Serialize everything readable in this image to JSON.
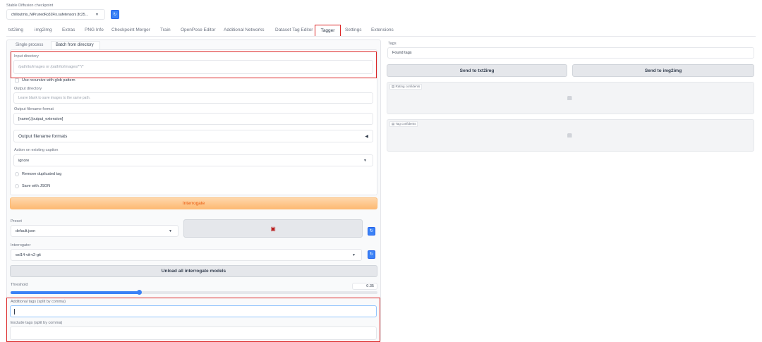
{
  "checkpoint": {
    "label": "Stable Diffusion checkpoint",
    "value": "chilloutmix_NiPrunedFp32Fix.safetensors [fc25…"
  },
  "tabs": [
    "txt2img",
    "img2img",
    "Extras",
    "PNG Info",
    "Checkpoint Merger",
    "Train",
    "OpenPose Editor",
    "Additional Networks",
    "Dataset Tag Editor",
    "Tagger",
    "Settings",
    "Extensions"
  ],
  "active_tab": "Tagger",
  "subtabs": [
    "Single process",
    "Batch from directory"
  ],
  "active_subtab": "Batch from directory",
  "batch": {
    "input_dir_label": "Input directory",
    "input_dir_placeholder": "/path/to/images or /path/to/images/**/*",
    "recursive_label": "Use recursive with glob pattern",
    "output_dir_label": "Output directory",
    "output_dir_placeholder": "Leave blank to save images to the same path.",
    "output_format_label": "Output filename format",
    "output_format_value": "[name].[output_extension]",
    "formats_accordion": "Output filename formats",
    "action_label": "Action on existing caption",
    "action_value": "ignore",
    "remove_dup_label": "Remove duplicated tag",
    "save_json_label": "Save with JSON"
  },
  "interrogate_button": "Interrogate",
  "preset": {
    "label": "Preset",
    "value": "default.json"
  },
  "interrogator": {
    "label": "Interrogator",
    "value": "wd14-vit-v2-git"
  },
  "unload_button": "Unload all interrogate models",
  "threshold": {
    "label": "Threshold",
    "value": "0.35",
    "fraction": 0.35
  },
  "additional_tags_label": "Additional tags (split by comma)",
  "exclude_tags_label": "Exclude tags (split by comma)",
  "right": {
    "tags_label": "Tags",
    "tags_value": "Found tags",
    "send_txt2img": "Send to txt2img",
    "send_img2img": "Send to img2img",
    "rating_label": "Rating confidents",
    "tag_conf_label": "Tag confidents"
  },
  "icons": {
    "refresh": "↻",
    "caret": "▼",
    "accordion": "◀",
    "save": "▣",
    "chart": "▤"
  },
  "colors": {
    "accent_orange": "#fdba74",
    "interrogate_text": "#ea580c",
    "highlight_red": "#dc2626",
    "refresh_blue": "#3b82f6",
    "slider_blue": "#3b82f6"
  }
}
